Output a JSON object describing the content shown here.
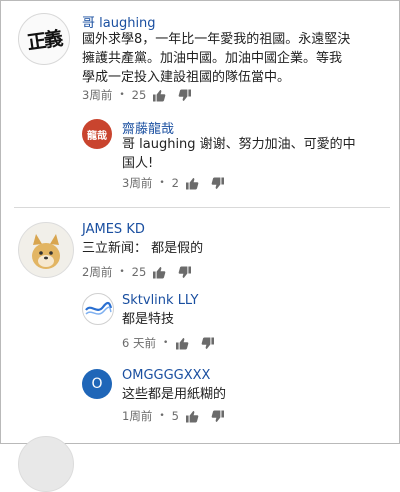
{
  "comments": [
    {
      "author": "哥 laughing",
      "avatar_text": "正義",
      "lines": [
        "國外求學8，一年比一年愛我的祖國。永遠堅決",
        "擁護共產黨。加油中國。加油中國企業。等我",
        "學成一定投入建設祖國的隊伍當中。"
      ],
      "time": "3周前",
      "likes": "25",
      "replies": [
        {
          "author": "齋藤龍哉",
          "avatar_text": "龍哉",
          "lines": [
            "哥 laughing 谢谢、努力加油、可愛的中",
            "国人!"
          ],
          "time": "3周前",
          "likes": "2"
        }
      ]
    },
    {
      "author": "JAMES KD",
      "lines": [
        "三立新闻： 都是假的"
      ],
      "time": "2周前",
      "likes": "25",
      "replies": [
        {
          "author": "Sktvlink LLY",
          "lines": [
            "都是特技"
          ],
          "time": "6 天前",
          "likes": ""
        },
        {
          "author": "OMGGGGXXX",
          "avatar_text": "O",
          "lines": [
            "这些都是用紙糊的"
          ],
          "time": "1周前",
          "likes": "5"
        }
      ]
    }
  ],
  "colors": {
    "author": "#1a4fa0",
    "reply_avatar_red": "#c9442e",
    "reply_avatar_blue": "#1f66b8"
  },
  "icons": [
    "thumbs-up-icon",
    "thumbs-down-icon"
  ]
}
